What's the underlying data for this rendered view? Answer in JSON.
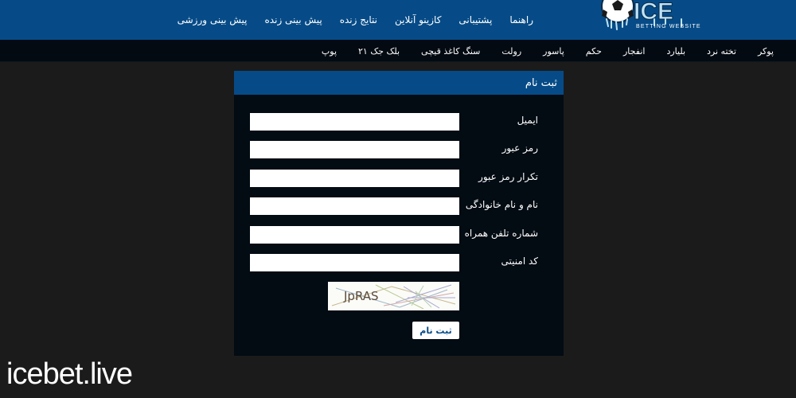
{
  "header": {
    "logo_text": "ICE",
    "logo_sub": "BETTING WEBSITE",
    "nav": [
      "پیش بینی ورزشی",
      "پیش بینی زنده",
      "نتایج زنده",
      "کازینو آنلاین",
      "پشتیبانی",
      "راهنما"
    ]
  },
  "subnav": [
    "پوکر",
    "تخته نرد",
    "بلیارد",
    "انفجار",
    "حکم",
    "پاسور",
    "رولت",
    "سنگ کاغذ قیچی",
    "بلک جک ۲۱",
    "پوپ"
  ],
  "form": {
    "title": "ثبت نام",
    "fields": [
      {
        "label": "ایمیل",
        "value": ""
      },
      {
        "label": "رمز عبور",
        "value": ""
      },
      {
        "label": "تکرار رمز عبور",
        "value": ""
      },
      {
        "label": "نام و نام خانوادگی",
        "value": ""
      },
      {
        "label": "شماره تلفن همراه",
        "value": ""
      },
      {
        "label": "کد امنیتی",
        "value": ""
      }
    ],
    "captcha_text": "JpRAS",
    "submit_label": "ثبت نام"
  },
  "watermark": "icebet.live",
  "colors": {
    "brand": "#064b87",
    "subbar": "#030a12",
    "panel": "#030b13",
    "background": "#1b1b1b"
  }
}
